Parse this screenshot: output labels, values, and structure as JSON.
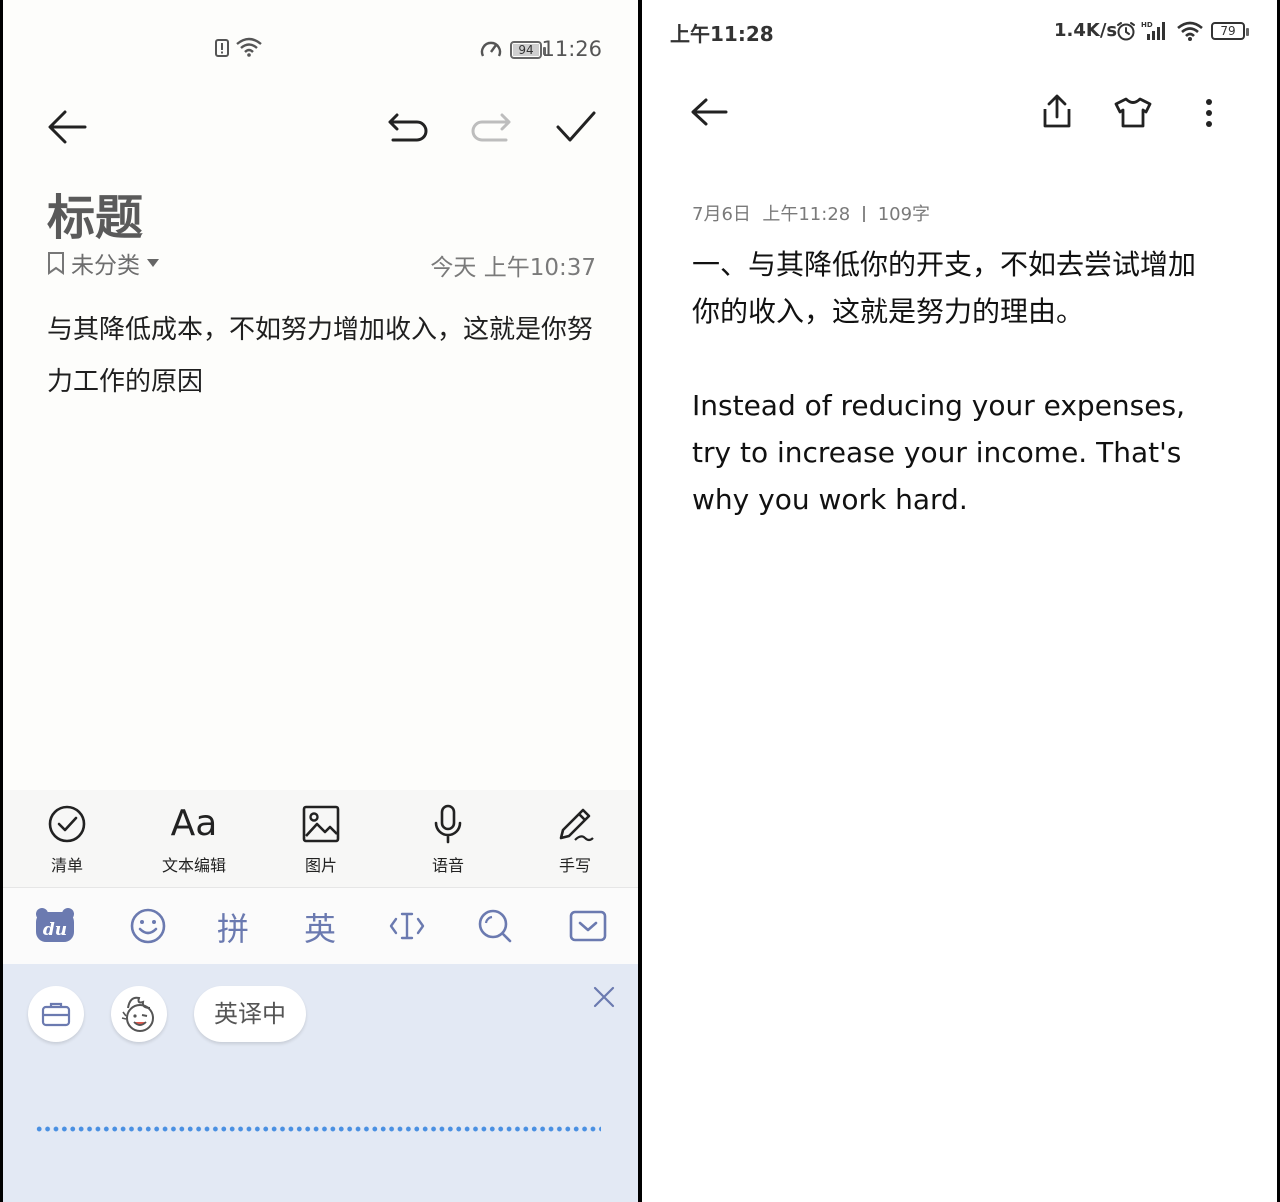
{
  "left_screen": {
    "status": {
      "time": "11:26",
      "battery": "94",
      "battery_level_percent": 94
    },
    "note": {
      "title": "标题",
      "category": "未分类",
      "date": "今天 上午10:37",
      "body": "与其降低成本，不如努力增加收入，这就是你努力工作的原因"
    },
    "toolbar": [
      {
        "label": "清单",
        "icon": "checklist-icon"
      },
      {
        "label": "文本编辑",
        "glyph": "Aa",
        "icon": "text-format-icon"
      },
      {
        "label": "图片",
        "icon": "image-icon"
      },
      {
        "label": "语音",
        "icon": "microphone-icon"
      },
      {
        "label": "手写",
        "icon": "pen-icon"
      }
    ],
    "ime": {
      "logo": "du",
      "pinyin_key": "拼",
      "english_key": "英",
      "translate_pill": "英译中"
    },
    "colors": {
      "ime_accent": "#6b7ab0",
      "voice_dots": "#4a90e2",
      "ime_panel_bg": "#e3e9f4"
    }
  },
  "right_screen": {
    "status": {
      "time": "上午11:28",
      "net_speed": "1.4K/s",
      "battery": "79",
      "battery_level_percent": 79
    },
    "note": {
      "date": "7月6日",
      "time": "上午11:28",
      "char_count": "109字",
      "body_cn": "一、与其降低你的开支，不如去尝试增加你的收入，这就是努力的理由。",
      "body_en": "Instead of reducing your expenses, try to increase your income. That's why you work hard."
    }
  }
}
